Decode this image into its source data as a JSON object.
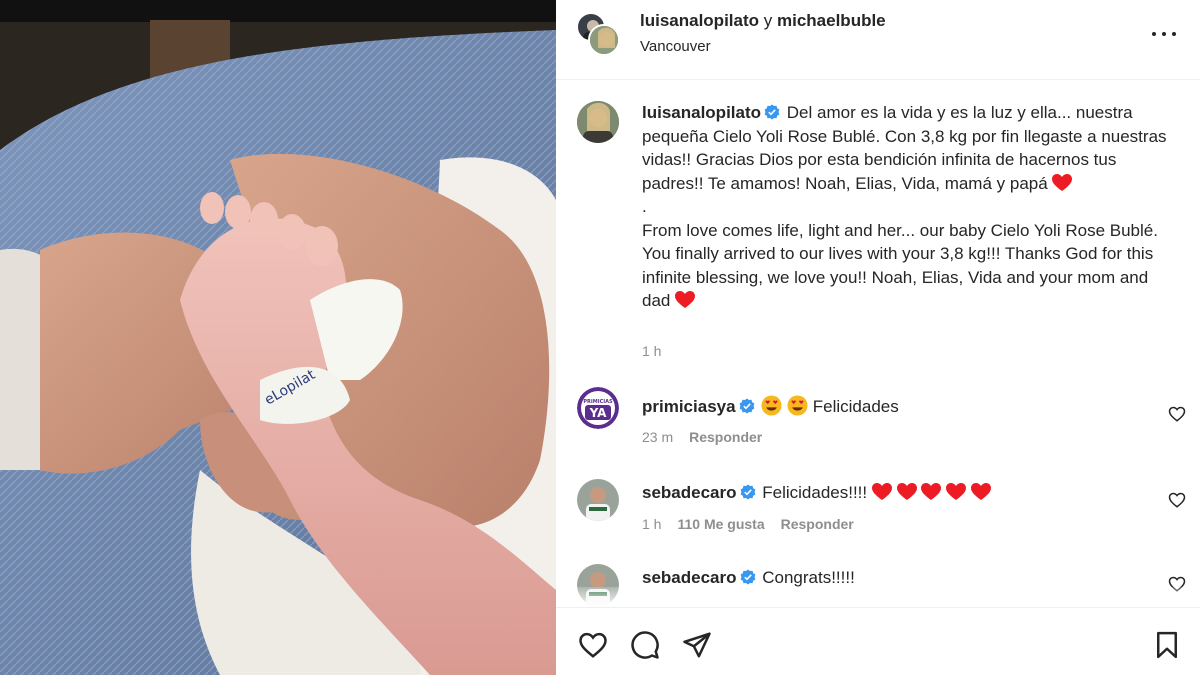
{
  "header": {
    "user1": "luisanalopilato",
    "joiner": "y",
    "user2": "michaelbuble",
    "location": "Vancouver"
  },
  "caption": {
    "username": "luisanalopilato",
    "text_es": "Del amor es la vida y es la luz y ella... nuestra pequeña Cielo Yoli Rose Bublé. Con 3,8 kg por fin llegaste a nuestras vidas!! Gracias Dios por esta bendición infinita de hacernos tus padres!! Te amamos! Noah, Elias, Vida, mamá y papá",
    "separator": ".",
    "text_en": "From love comes life, light and her... our baby Cielo Yoli Rose Bublé. You finally arrived to our lives with your 3,8 kg!!! Thanks God for this infinite blessing, we love you!! Noah, Elias, Vida and your mom and dad",
    "time": "1 h"
  },
  "comments": [
    {
      "username": "primiciasya",
      "avatar_label": "YA",
      "avatar_top": "PRIMICIAS",
      "text": "Felicidades",
      "time": "23 m",
      "likes": "",
      "reply": "Responder"
    },
    {
      "username": "sebadecaro",
      "text": "Felicidades!!!!",
      "time": "1 h",
      "likes": "110 Me gusta",
      "reply": "Responder"
    },
    {
      "username": "sebadecaro",
      "text": "Congrats!!!!!",
      "time": "",
      "likes": "",
      "reply": ""
    }
  ],
  "icons": {
    "more": "more-options-icon",
    "like": "heart-outline-icon",
    "comment": "comment-icon",
    "share": "paper-plane-icon",
    "save": "bookmark-icon",
    "verified": "verified-badge-icon"
  },
  "colors": {
    "verified": "#3897f0",
    "heart": "#ed1c24",
    "primicias": "#5b2d8e"
  }
}
